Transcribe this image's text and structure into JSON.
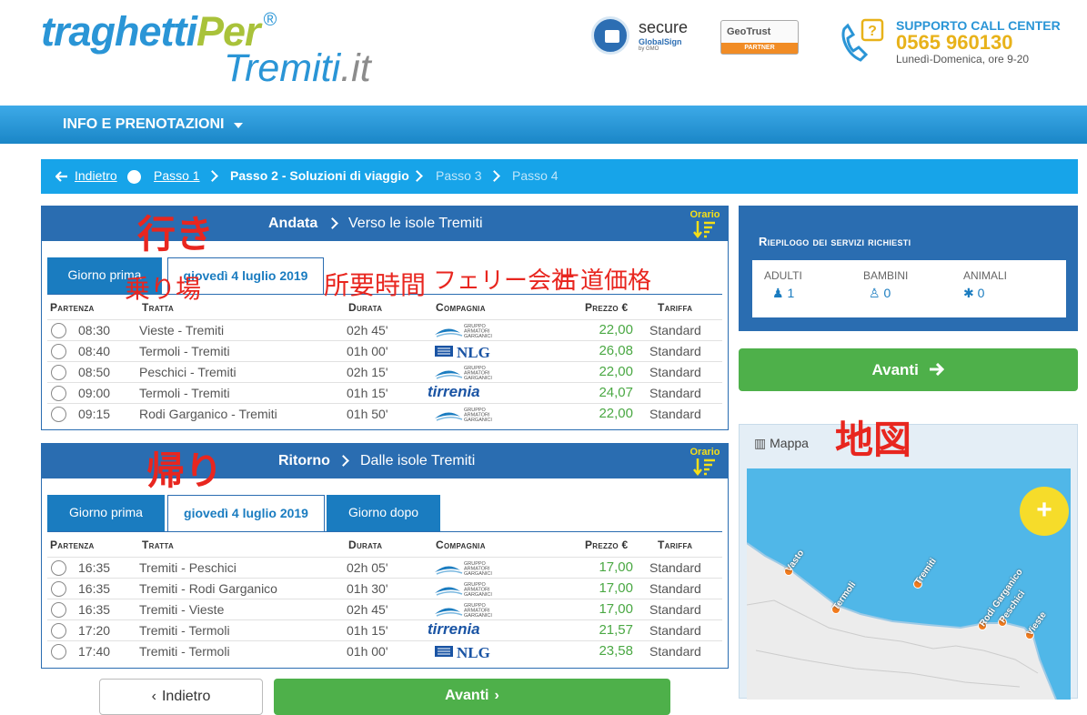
{
  "header": {
    "logo_part1": "traghetti",
    "logo_part2": "Per",
    "logo_reg": "®",
    "logo_line2": "Tremiti",
    "logo_tld": ".it",
    "secure_title": "secure",
    "secure_sub": "GlobalSign",
    "secure_by": "by GMO",
    "geotrust": "GeoTrust",
    "geotrust_partner": "PARTNER",
    "callcenter_label": "SUPPORTO CALL CENTER",
    "phone": "0565 960130",
    "hours": "Lunedì-Domenica, ore 9-20"
  },
  "nav": {
    "menu_label": "INFO E PRENOTAZIONI"
  },
  "breadcrumb": {
    "back": "Indietro",
    "step1": "Passo 1",
    "step2": "Passo 2 - Soluzioni di viaggio",
    "step3": "Passo 3",
    "step4": "Passo 4"
  },
  "columns": {
    "partenza": "Partenza",
    "tratta": "Tratta",
    "durata": "Durata",
    "compagnia": "Compagnia",
    "prezzo": "Prezzo €",
    "tariffa": "Tariffa"
  },
  "outbound": {
    "title": "Andata",
    "subtitle": "Verso le isole Tremiti",
    "sort_label": "Orario",
    "prev_day": "Giorno prima",
    "date": "giovedì 4 luglio 2019",
    "rows": [
      {
        "time": "08:30",
        "route": "Vieste - Tremiti",
        "duration": "02h 45'",
        "company": "gam",
        "price": "22,00",
        "fare": "Standard"
      },
      {
        "time": "08:40",
        "route": "Termoli - Tremiti",
        "duration": "01h 00'",
        "company": "nlg",
        "price": "26,08",
        "fare": "Standard"
      },
      {
        "time": "08:50",
        "route": "Peschici - Tremiti",
        "duration": "02h 15'",
        "company": "gam",
        "price": "22,00",
        "fare": "Standard"
      },
      {
        "time": "09:00",
        "route": "Termoli - Tremiti",
        "duration": "01h 15'",
        "company": "tirrenia",
        "price": "24,07",
        "fare": "Standard"
      },
      {
        "time": "09:15",
        "route": "Rodi Garganico - Tremiti",
        "duration": "01h 50'",
        "company": "gam",
        "price": "22,00",
        "fare": "Standard"
      }
    ]
  },
  "return": {
    "title": "Ritorno",
    "subtitle": "Dalle isole Tremiti",
    "sort_label": "Orario",
    "prev_day": "Giorno prima",
    "date": "giovedì 4 luglio 2019",
    "next_day": "Giorno dopo",
    "rows": [
      {
        "time": "16:35",
        "route": "Tremiti - Peschici",
        "duration": "02h 05'",
        "company": "gam",
        "price": "17,00",
        "fare": "Standard"
      },
      {
        "time": "16:35",
        "route": "Tremiti - Rodi Garganico",
        "duration": "01h 30'",
        "company": "gam",
        "price": "17,00",
        "fare": "Standard"
      },
      {
        "time": "16:35",
        "route": "Tremiti - Vieste",
        "duration": "02h 45'",
        "company": "gam",
        "price": "17,00",
        "fare": "Standard"
      },
      {
        "time": "17:20",
        "route": "Tremiti - Termoli",
        "duration": "01h 15'",
        "company": "tirrenia",
        "price": "21,57",
        "fare": "Standard"
      },
      {
        "time": "17:40",
        "route": "Tremiti - Termoli",
        "duration": "01h 00'",
        "company": "nlg",
        "price": "23,58",
        "fare": "Standard"
      }
    ]
  },
  "logos": {
    "gam": "GRUPPO ARMATORI GARGANICI",
    "nlg": "NLG",
    "tirrenia": "tirrenia"
  },
  "summary": {
    "title": "Riepilogo dei servizi richiesti",
    "adulti_label": "ADULTI",
    "adulti_value": "1",
    "bambini_label": "BAMBINI",
    "bambini_value": "0",
    "animali_label": "ANIMALI",
    "animali_value": "0"
  },
  "avanti_label": "Avanti",
  "map": {
    "title": "Mappa",
    "ports": [
      "Vasto",
      "Termoli",
      "Tremiti",
      "Rodi Garganico",
      "Peschici",
      "Vieste"
    ]
  },
  "bottom": {
    "back": "Indietro",
    "next": "Avanti"
  },
  "annotations": {
    "outbound": "行き",
    "return": "帰り",
    "pier": "乗り場",
    "duration": "所要時間",
    "company": "フェリー会社",
    "price": "片道価格",
    "map": "地図"
  },
  "colors": {
    "brand_blue": "#2a6db1",
    "breadcrumb_blue": "#17a4e9",
    "price_green": "#4aa843",
    "button_green": "#4eb04a",
    "sort_yellow": "#f6df17",
    "annotation_red": "#e8261f"
  }
}
